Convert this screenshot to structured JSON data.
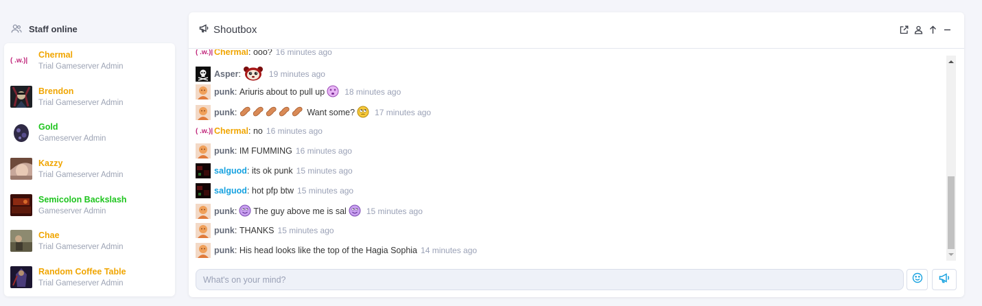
{
  "staff": {
    "title": "Staff online",
    "items": [
      {
        "name": "Chermal",
        "role": "Trial Gameserver Admin",
        "name_color": "#f0a500",
        "avatar": "text-face",
        "avatar_text": "( .w.)|"
      },
      {
        "name": "Brendon",
        "role": "Trial Gameserver Admin",
        "name_color": "#f0a500",
        "avatar": "dark-hair-avatar"
      },
      {
        "name": "Gold",
        "role": "Gameserver Admin",
        "name_color": "#1ec41e",
        "avatar": "dark-blob-avatar"
      },
      {
        "name": "Kazzy",
        "role": "Trial Gameserver Admin",
        "name_color": "#f0a500",
        "avatar": "portrait-avatar"
      },
      {
        "name": "Semicolon Backslash",
        "role": "Gameserver Admin",
        "name_color": "#1ec41e",
        "avatar": "red-room-avatar"
      },
      {
        "name": "Chae",
        "role": "Trial Gameserver Admin",
        "name_color": "#f0a500",
        "avatar": "photo-avatar"
      },
      {
        "name": "Random Coffee Table",
        "role": "Trial Gameserver Admin",
        "name_color": "#f0a500",
        "avatar": "purple-knight-avatar"
      }
    ]
  },
  "shoutbox": {
    "title": "Shoutbox",
    "tools": [
      "popout-icon",
      "user-icon",
      "arrow-up-icon",
      "minimize-icon"
    ],
    "partial_top": {
      "author": "Chermal",
      "text": "ooo?",
      "time": "16 minutes ago"
    },
    "messages": [
      {
        "author": "Asper",
        "author_color": "#666c7a",
        "before": "",
        "after": "",
        "emoji": "panda-emoji",
        "time": "19 minutes ago",
        "avatar": "skull-avatar"
      },
      {
        "author": "punk",
        "author_color": "#666c7a",
        "before": "Ariuris about to pull up",
        "after": "",
        "emoji": "pink-dizzy-emoji",
        "time": "18 minutes ago",
        "avatar": "orange-avatar"
      },
      {
        "author": "punk",
        "author_color": "#666c7a",
        "before": "",
        "after": "Want some?",
        "emoji": "peanuts-emoji",
        "emoji2": "eye-roll-emoji",
        "time": "17 minutes ago",
        "avatar": "orange-avatar"
      },
      {
        "author": "Chermal",
        "author_color": "#f0a500",
        "before": "no",
        "after": "",
        "emoji": "",
        "time": "16 minutes ago",
        "avatar": "text-face",
        "avatar_text": "( .w.)|"
      },
      {
        "author": "punk",
        "author_color": "#666c7a",
        "before": "IM FUMMING",
        "after": "",
        "emoji": "",
        "time": "16 minutes ago",
        "avatar": "orange-avatar"
      },
      {
        "author": "salguod",
        "author_color": "#17a2e0",
        "before": "its ok punk",
        "after": "",
        "emoji": "",
        "time": "15 minutes ago",
        "avatar": "dark-red-avatar"
      },
      {
        "author": "salguod",
        "author_color": "#17a2e0",
        "before": "hot pfp btw",
        "after": "",
        "emoji": "",
        "time": "15 minutes ago",
        "avatar": "dark-red-avatar"
      },
      {
        "author": "punk",
        "author_color": "#666c7a",
        "before": "",
        "after": "The guy above me is sal",
        "emoji": "purple-smile-emoji",
        "emoji2": "purple-smile-emoji",
        "time": "15 minutes ago",
        "avatar": "orange-avatar"
      },
      {
        "author": "punk",
        "author_color": "#666c7a",
        "before": "THANKS",
        "after": "",
        "emoji": "",
        "time": "15 minutes ago",
        "avatar": "orange-avatar"
      },
      {
        "author": "punk",
        "author_color": "#666c7a",
        "before": "His head looks like the top of the Hagia Sophia",
        "after": "",
        "emoji": "",
        "time": "14 minutes ago",
        "avatar": "orange-avatar"
      }
    ],
    "input_placeholder": "What's on your mind?",
    "emoji_button_icon": "smiley-icon",
    "send_button_icon": "megaphone-icon"
  },
  "colors": {
    "accent": "#17a2e0",
    "trial_admin": "#f0a500",
    "admin": "#1ec41e",
    "muted": "#9aa1b6"
  }
}
